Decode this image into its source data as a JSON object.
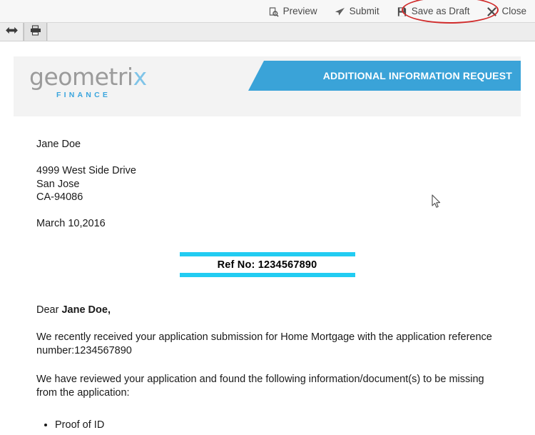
{
  "toolbar": {
    "actions": [
      {
        "label": "Preview",
        "icon": "preview-document-icon"
      },
      {
        "label": "Submit",
        "icon": "paper-plane-icon"
      },
      {
        "label": "Save as Draft",
        "icon": "floppy-disk-save-icon"
      },
      {
        "label": "Close",
        "icon": "close-x-icon"
      }
    ]
  },
  "sub_toolbar": {
    "buttons": [
      {
        "name": "navigate-back-forward",
        "icon": "double-arrow-icon"
      },
      {
        "name": "print",
        "icon": "printer-icon"
      }
    ]
  },
  "document": {
    "logo": {
      "word_main": "geometri",
      "word_accent": "x",
      "subtitle": "FINANCE"
    },
    "banner_title": "ADDITIONAL INFORMATION REQUEST",
    "recipient_name": "Jane Doe",
    "address_line1": "4999 West Side Drive",
    "address_line2": "San Jose",
    "address_line3": "CA-94086",
    "date": "March 10,2016",
    "ref_label": "Ref No: 1234567890",
    "salutation_prefix": "Dear ",
    "salutation_name": "Jane Doe,",
    "paragraph1": "We recently received your application submission for Home Mortgage with the application reference number:1234567890",
    "paragraph2": "We have reviewed your application and found the following information/document(s) to be missing from the application:",
    "missing_items": [
      "Proof of ID"
    ]
  },
  "annotation": {
    "shape": "red-ellipse-highlight",
    "target": "Save as Draft"
  },
  "colors": {
    "banner_blue": "#3aa3d8",
    "ref_cyan": "#22ccf2",
    "logo_gray": "#9b9b9b",
    "logo_blue": "#3aa5dd",
    "annotation_red": "#d02b2b"
  }
}
